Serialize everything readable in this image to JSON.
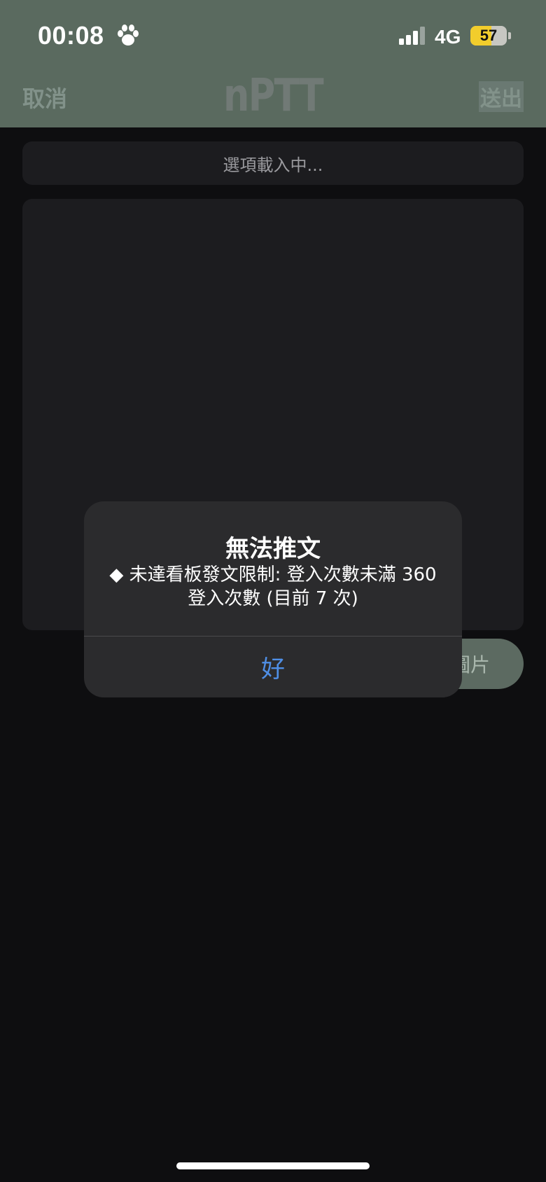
{
  "status_bar": {
    "time": "00:08",
    "network": "4G",
    "battery_level": "57",
    "battery_percent": 57
  },
  "nav": {
    "cancel_label": "取消",
    "title": "nPTT",
    "send_label": "送出"
  },
  "form": {
    "options_loading": "選項載入中...",
    "image_button_label": "圖片"
  },
  "alert": {
    "title": "無法推文",
    "message_line1": "◆ 未達看板發文限制: 登入次數未滿 360",
    "message_line2": "登入次數 (目前 7 次)",
    "ok_label": "好"
  },
  "colors": {
    "header": "#5a6a5f",
    "background": "#0e0e10",
    "panel": "#1c1c1f",
    "alert_bg": "#2b2b2d",
    "accent_blue": "#4f8fe6",
    "battery_yellow": "#f2cd2c"
  },
  "icons": {
    "paw": "paw-icon",
    "signal": "cellular-signal-icon",
    "battery": "battery-icon"
  }
}
